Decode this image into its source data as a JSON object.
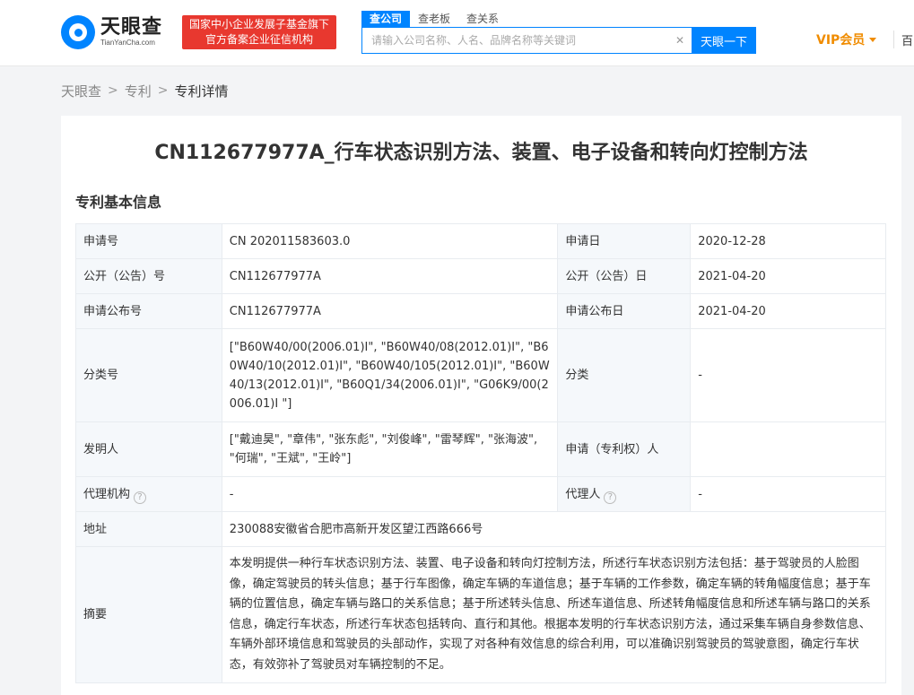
{
  "header": {
    "logo_cn": "天眼查",
    "logo_en": "TianYanCha.com",
    "badge_line1": "国家中小企业发展子基金旗下",
    "badge_line2": "官方备案企业征信机构",
    "search_tabs": [
      "查公司",
      "查老板",
      "查关系"
    ],
    "search_placeholder": "请输入公司名称、人名、品牌名称等关键词",
    "search_button": "天眼一下",
    "vip_label": "VIP会员",
    "more_label": "百"
  },
  "breadcrumb": [
    "天眼查",
    "专利",
    "专利详情"
  ],
  "patent": {
    "title": "CN112677977A_行车状态识别方法、装置、电子设备和转向灯控制方法",
    "section_title": "专利基本信息",
    "rows": {
      "app_no_label": "申请号",
      "app_no": "CN 202011583603.0",
      "app_date_label": "申请日",
      "app_date": "2020-12-28",
      "pub_no_label": "公开（公告）号",
      "pub_no": "CN112677977A",
      "pub_date_label": "公开（公告）日",
      "pub_date": "2021-04-20",
      "app_pub_no_label": "申请公布号",
      "app_pub_no": "CN112677977A",
      "app_pub_date_label": "申请公布日",
      "app_pub_date": "2021-04-20",
      "class_no_label": "分类号",
      "class_no": "[\"B60W40/00(2006.01)I\", \"B60W40/08(2012.01)I\", \"B60W40/10(2012.01)I\", \"B60W40/105(2012.01)I\", \"B60W40/13(2012.01)I\", \"B60Q1/34(2006.01)I\", \"G06K9/00(2006.01)I \"]",
      "class_label": "分类",
      "class_value": "-",
      "inventor_label": "发明人",
      "inventors": "[\"戴迪昊\", \"章伟\", \"张东彪\", \"刘俊峰\", \"雷琴辉\", \"张海波\", \"何瑞\", \"王斌\", \"王岭\"]",
      "applicant_label": "申请（专利权）人",
      "applicant": "",
      "agency_label": "代理机构",
      "agency": "-",
      "agent_label": "代理人",
      "agent": "-",
      "address_label": "地址",
      "address": "230088安徽省合肥市高新开发区望江西路666号",
      "abstract_label": "摘要",
      "abstract": "本发明提供一种行车状态识别方法、装置、电子设备和转向灯控制方法，所述行车状态识别方法包括：基于驾驶员的人脸图像，确定驾驶员的转头信息；基于行车图像，确定车辆的车道信息；基于车辆的工作参数，确定车辆的转角幅度信息；基于车辆的位置信息，确定车辆与路口的关系信息；基于所述转头信息、所述车道信息、所述转角幅度信息和所述车辆与路口的关系信息，确定行车状态，所述行车状态包括转向、直行和其他。根据本发明的行车状态识别方法，通过采集车辆自身参数信息、车辆外部环境信息和驾驶员的头部动作，实现了对各种有效信息的综合利用，可以准确识别驾驶员的驾驶意图，确定行车状态，有效弥补了驾驶员对车辆控制的不足。"
    }
  }
}
